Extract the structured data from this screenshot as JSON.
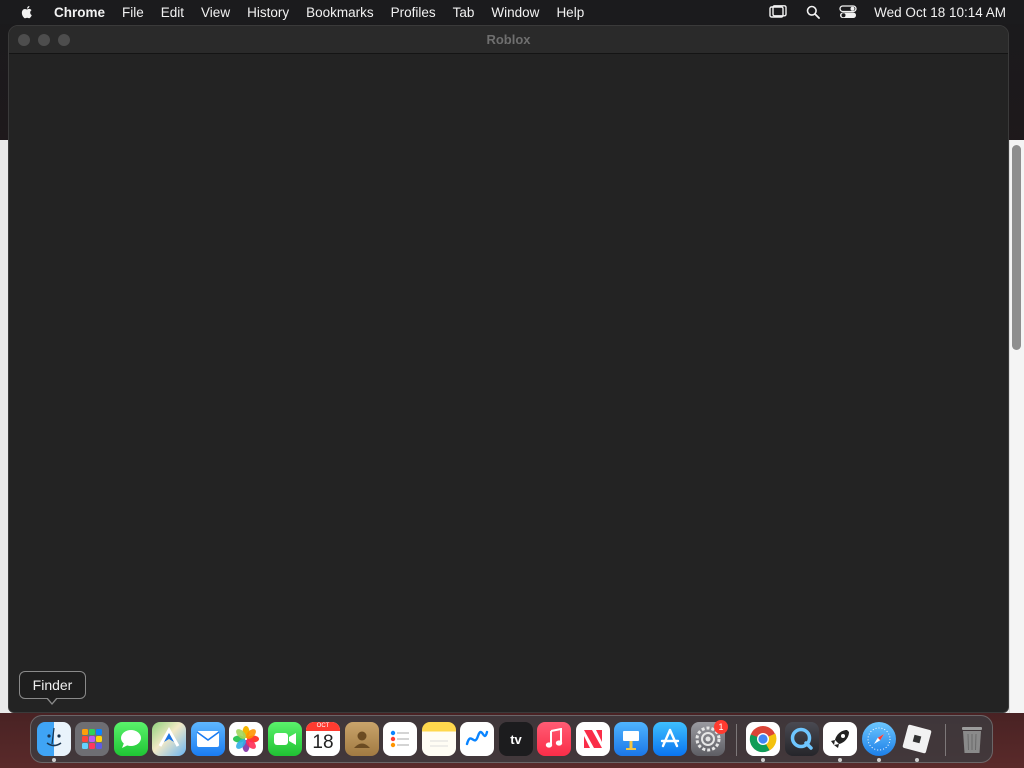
{
  "menubar": {
    "apple_icon": "apple-logo-icon",
    "app_name": "Chrome",
    "items": [
      "File",
      "Edit",
      "View",
      "History",
      "Bookmarks",
      "Profiles",
      "Tab",
      "Window",
      "Help"
    ],
    "status_icons": [
      "screen-mirroring-icon",
      "spotlight-search-icon",
      "control-center-icon"
    ],
    "clock": "Wed Oct 18  10:14 AM"
  },
  "window": {
    "title": "Roblox"
  },
  "tooltip": {
    "text": "Finder"
  },
  "dock": {
    "apps": [
      {
        "name": "Finder",
        "icon": "finder-icon",
        "running": true
      },
      {
        "name": "Launchpad",
        "icon": "launchpad-icon",
        "running": false
      },
      {
        "name": "Messages",
        "icon": "messages-icon",
        "running": false
      },
      {
        "name": "Maps",
        "icon": "maps-icon",
        "running": false
      },
      {
        "name": "Mail",
        "icon": "mail-icon",
        "running": false
      },
      {
        "name": "Photos",
        "icon": "photos-icon",
        "running": false
      },
      {
        "name": "FaceTime",
        "icon": "facetime-icon",
        "running": false
      },
      {
        "name": "Calendar",
        "icon": "calendar-icon",
        "running": false,
        "month": "OCT",
        "day": "18"
      },
      {
        "name": "Contacts",
        "icon": "contacts-icon",
        "running": false
      },
      {
        "name": "Reminders",
        "icon": "reminders-icon",
        "running": false
      },
      {
        "name": "Notes",
        "icon": "notes-icon",
        "running": false
      },
      {
        "name": "Freeform",
        "icon": "freeform-icon",
        "running": false
      },
      {
        "name": "TV",
        "icon": "apple-tv-icon",
        "running": false,
        "label": "tv"
      },
      {
        "name": "Music",
        "icon": "music-icon",
        "running": false
      },
      {
        "name": "News",
        "icon": "news-icon",
        "running": false
      },
      {
        "name": "Keynote",
        "icon": "keynote-icon",
        "running": false
      },
      {
        "name": "App Store",
        "icon": "app-store-icon",
        "running": false
      },
      {
        "name": "System Settings",
        "icon": "system-settings-icon",
        "running": false,
        "badge": "1"
      },
      {
        "name": "Google Chrome",
        "icon": "chrome-icon",
        "running": true
      },
      {
        "name": "QuickTime",
        "icon": "quicktime-icon",
        "running": false
      },
      {
        "name": "Rocket",
        "icon": "rocket-icon",
        "running": true
      },
      {
        "name": "Safari",
        "icon": "safari-icon",
        "running": true
      },
      {
        "name": "Roblox",
        "icon": "roblox-icon",
        "running": true
      },
      {
        "name": "Trash",
        "icon": "trash-icon",
        "running": false
      }
    ]
  }
}
